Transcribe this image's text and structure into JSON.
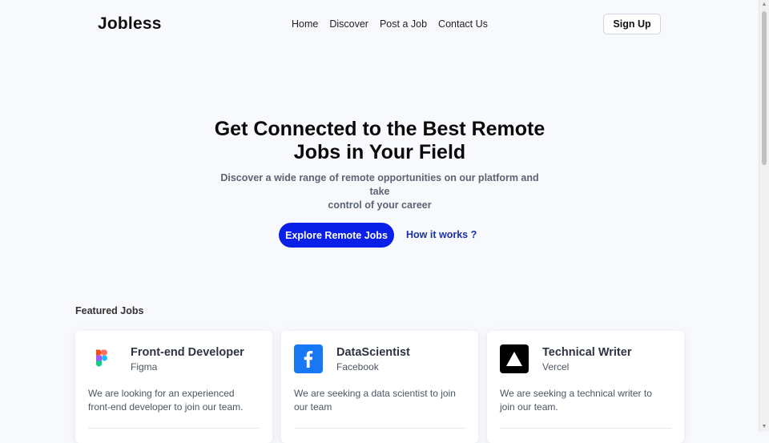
{
  "header": {
    "logo": "Jobless",
    "nav": [
      "Home",
      "Discover",
      "Post a Job",
      "Contact Us"
    ],
    "signup_label": "Sign Up"
  },
  "hero": {
    "title_line1": "Get Connected to the Best Remote",
    "title_line2": "Jobs in Your Field",
    "subtitle_line1": "Discover a wide range of remote opportunities on our platform and take",
    "subtitle_line2": "control of your career",
    "primary_button": "Explore Remote Jobs",
    "secondary_link": "How it works ?"
  },
  "featured": {
    "title": "Featured Jobs",
    "jobs": [
      {
        "title": "Front-end Developer",
        "company": "Figma",
        "icon": "figma-logo-icon",
        "desc_line1": "We are looking for an experienced",
        "desc_line2": "front-end developer to join our team."
      },
      {
        "title": "DataScientist",
        "company": "Facebook",
        "icon": "facebook-logo-icon",
        "desc_line1": "We are seeking a data scientist to join",
        "desc_line2": "our team"
      },
      {
        "title": "Technical Writer",
        "company": "Vercel",
        "icon": "vercel-logo-icon",
        "desc_line1": "We are seeking a technical writer to",
        "desc_line2": "join our team."
      }
    ]
  },
  "colors": {
    "background": "#f7f9fc",
    "primary": "#0a1fe8",
    "link": "#1b2fa6",
    "facebook": "#1877f2"
  }
}
